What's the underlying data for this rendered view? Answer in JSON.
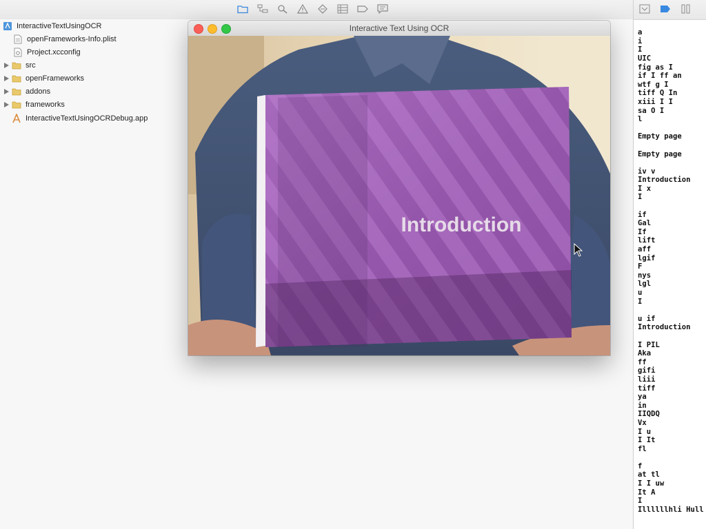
{
  "toolbar": {
    "icons": [
      "folder-icon",
      "hierarchy-icon",
      "search-icon",
      "warning-icon",
      "diamond-icon",
      "list-icon",
      "tag-icon",
      "comment-icon"
    ]
  },
  "navigator": {
    "items": [
      {
        "label": "InteractiveTextUsingOCR",
        "icon": "project-icon",
        "expandable": false
      },
      {
        "label": "openFrameworks-Info.plist",
        "icon": "plist-icon",
        "expandable": false
      },
      {
        "label": "Project.xcconfig",
        "icon": "config-icon",
        "expandable": false
      },
      {
        "label": "src",
        "icon": "folder-icon",
        "expandable": true
      },
      {
        "label": "openFrameworks",
        "icon": "folder-icon",
        "expandable": true
      },
      {
        "label": "addons",
        "icon": "folder-icon",
        "expandable": true
      },
      {
        "label": "frameworks",
        "icon": "folder-icon",
        "expandable": true
      },
      {
        "label": "InteractiveTextUsingOCRDebug.app",
        "icon": "app-icon",
        "expandable": false
      }
    ]
  },
  "window": {
    "title": "Interactive Text Using OCR",
    "book_title": "Introduction"
  },
  "ocr_output": "yn Q I\n\na\ni\nI\nUIC\nfig as I\nif I ff an\nwtf g I\ntiff Q In\nxiii I I\nsa O I\nl\n\nEmpty page\n\nEmpty page\n\niv v\nIntroduction\nI x\nI\n\nif\nGal\nIf\nlift\naff\nlgif\nF\nnys\nlgl\nu\nI\n\nu if\nIntroduction\n\nI PIL\nAka\nff\ngifi\nliii\ntiff\nya\nin\nIIQDQ\nVx\nI u\nI It\nfl\n\nf\nat tl\nI I uw\nIt A\nI\nIllllllhli Hull",
  "colors": {
    "close": "#fc5f57",
    "minimize": "#fdbc2e",
    "maximize": "#33c748",
    "folder": "#e9c96b",
    "accent": "#3a89e0",
    "book": "#9d5cb0"
  }
}
